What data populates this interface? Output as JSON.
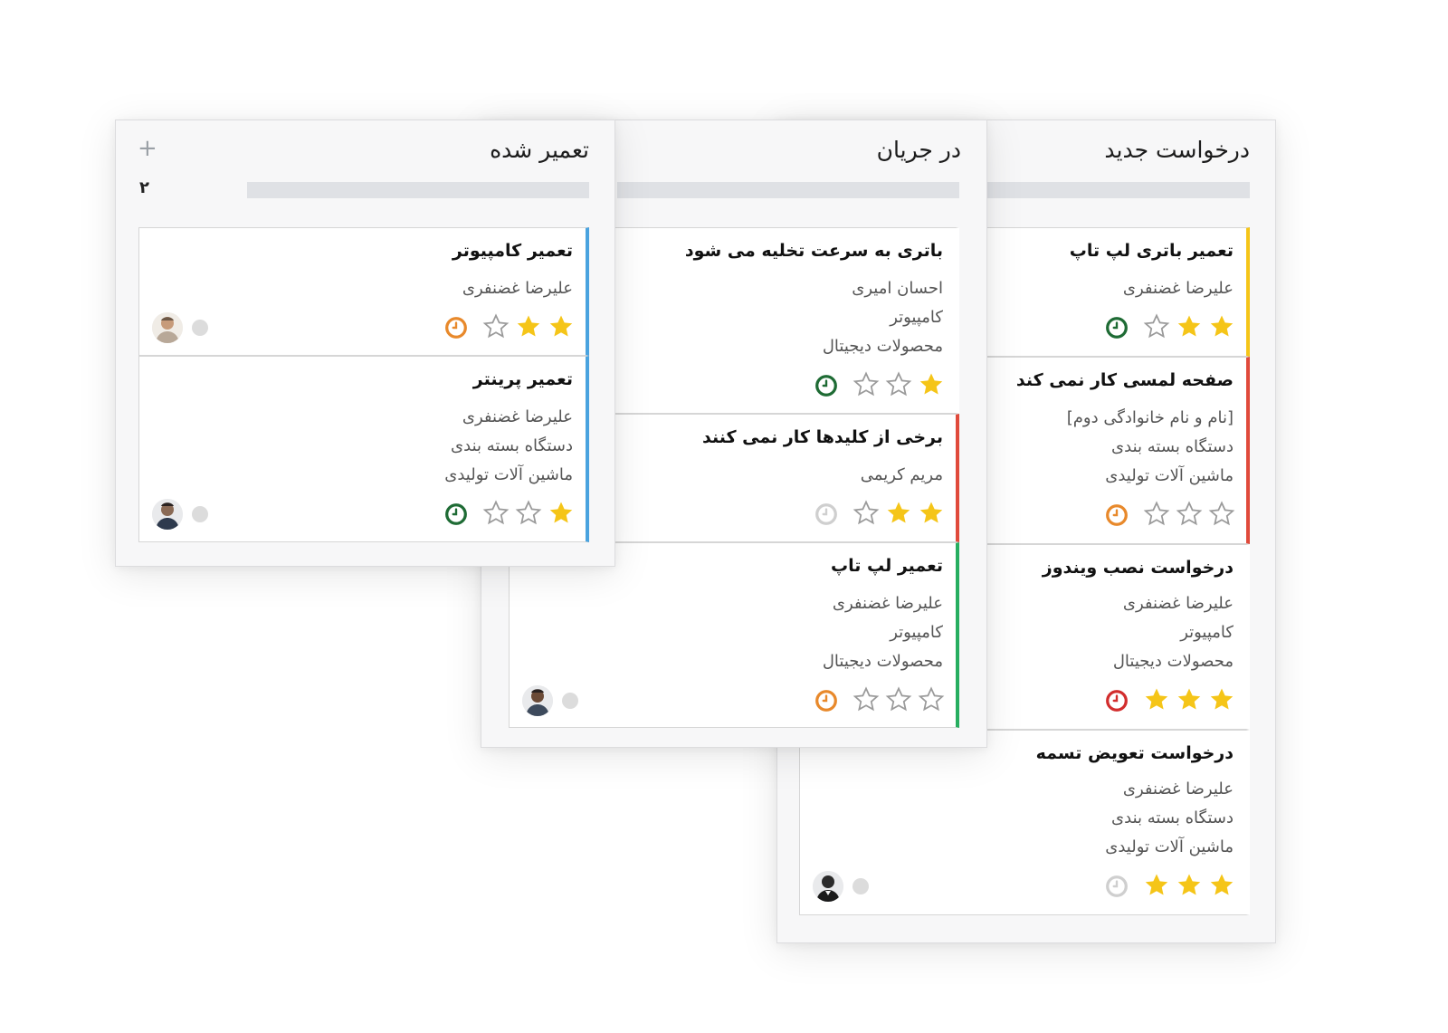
{
  "columns": [
    {
      "title": "درخواست جدید",
      "cards": [
        {
          "title": "تعمیر باتری لپ تاپ",
          "lines": [
            "علیرضا غضنفری"
          ],
          "stars": 2,
          "clock": "#1e6b34",
          "accent": "#f5c518"
        },
        {
          "title": "صفحه لمسی کار نمی کند",
          "lines": [
            "[نام و نام خانوادگی دوم]",
            "دستگاه بسته بندی",
            "ماشین آلات تولیدی"
          ],
          "stars": 0,
          "clock": "#e8892b",
          "accent": "#e04a3b"
        },
        {
          "title": "درخواست نصب ویندوز",
          "lines": [
            "علیرضا غضنفری",
            "کامپیوتر",
            "محصولات دیجیتال"
          ],
          "stars": 3,
          "clock": "#d22d2d",
          "accent": ""
        },
        {
          "title": "درخواست تعویض تسمه",
          "lines": [
            "علیرضا غضنفری",
            "دستگاه بسته بندی",
            "ماشین آلات تولیدی"
          ],
          "stars": 3,
          "clock": "#cfcfcf",
          "accent": ""
        }
      ]
    },
    {
      "title": "در جریان",
      "cards": [
        {
          "title": "باتری به سرعت تخلیه می شود",
          "lines": [
            "احسان امیری",
            "کامپیوتر",
            "محصولات دیجیتال"
          ],
          "stars": 1,
          "clock": "#1e6b34",
          "accent": ""
        },
        {
          "title": "برخی از کلیدها کار نمی کنند",
          "lines": [
            "مریم کریمی"
          ],
          "stars": 2,
          "clock": "#cfcfcf",
          "accent": "#e04a3b"
        },
        {
          "title": "تعمیر لپ تاپ",
          "lines": [
            "علیرضا غضنفری",
            "کامپیوتر",
            "محصولات دیجیتال"
          ],
          "stars": 0,
          "clock": "#e8892b",
          "accent": "#27ae60"
        }
      ]
    },
    {
      "title": "تعمیر شده",
      "count": "۲",
      "add_icon": "+",
      "cards": [
        {
          "title": "تعمیر کامپیوتر",
          "lines": [
            "علیرضا غضنفری"
          ],
          "stars": 2,
          "clock": "#e8892b",
          "accent": "#4aa3df"
        },
        {
          "title": "تعمیر پرینتر",
          "lines": [
            "علیرضا غضنفری",
            "دستگاه بسته بندی",
            "ماشین آلات تولیدی"
          ],
          "stars": 1,
          "clock": "#1e6b34",
          "accent": "#4aa3df"
        }
      ]
    }
  ],
  "colors": {
    "star_filled": "#f5c518",
    "star_empty_stroke": "#9a9a9a",
    "column_bg": "#f7f7f8",
    "bar": "#dfe1e5"
  }
}
